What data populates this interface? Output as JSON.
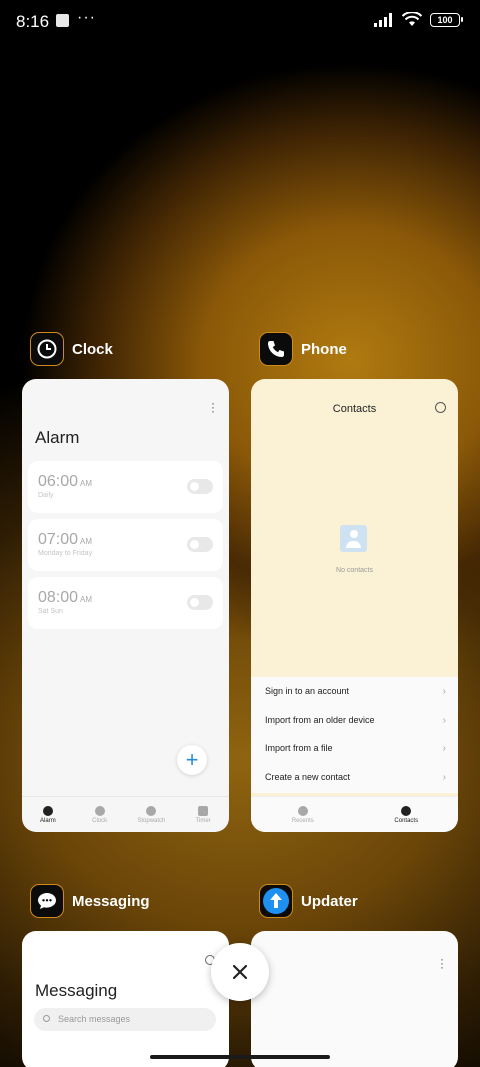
{
  "status_bar": {
    "time": "8:16",
    "dots": "···",
    "battery": "100"
  },
  "apps": {
    "clock": {
      "name": "Clock",
      "title": "Alarm",
      "alarms": [
        {
          "time": "06:00",
          "ampm": "AM",
          "repeat": "Daily"
        },
        {
          "time": "07:00",
          "ampm": "AM",
          "repeat": "Monday to Friday"
        },
        {
          "time": "08:00",
          "ampm": "AM",
          "repeat": "Sat Sun"
        }
      ],
      "nav": [
        "Alarm",
        "Clock",
        "Stopwatch",
        "Timer"
      ]
    },
    "phone": {
      "name": "Phone",
      "title": "Contacts",
      "empty_text": "No contacts",
      "options": [
        "Sign in to an account",
        "Import from an older device",
        "Import from a file",
        "Create a new contact"
      ],
      "nav": [
        "Recents",
        "Contacts"
      ]
    },
    "messaging": {
      "name": "Messaging",
      "title": "Messaging",
      "search_placeholder": "Search messages"
    },
    "updater": {
      "name": "Updater"
    }
  }
}
